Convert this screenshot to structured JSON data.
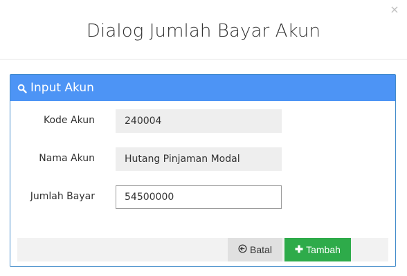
{
  "dialog": {
    "title": "Dialog Jumlah Bayar Akun",
    "close_label": "×"
  },
  "panel": {
    "heading": "Input Akun",
    "heading_icon": "search-icon",
    "colors": {
      "heading_bg": "#4d94f5",
      "add_button_bg": "#2eab4a"
    }
  },
  "form": {
    "kode_akun": {
      "label": "Kode Akun",
      "value": "240004"
    },
    "nama_akun": {
      "label": "Nama Akun",
      "value": "Hutang Pinjaman Modal"
    },
    "jumlah_bayar": {
      "label": "Jumlah Bayar",
      "value": "54500000"
    }
  },
  "footer": {
    "cancel_label": "Batal",
    "cancel_icon": "arrow-left-circle-icon",
    "add_label": "Tambah",
    "add_icon": "plus-icon"
  }
}
